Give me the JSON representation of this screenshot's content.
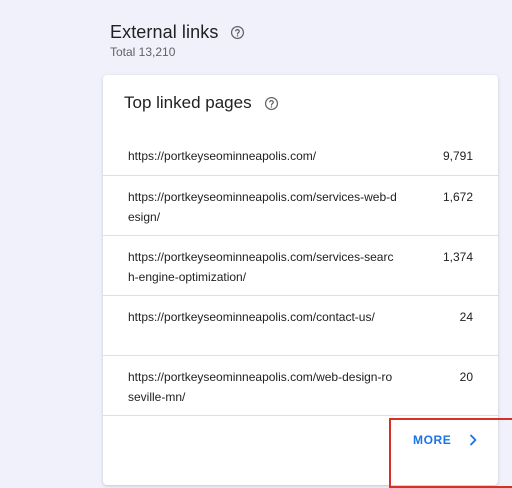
{
  "external_links": {
    "title": "External links",
    "total": "Total 13,210"
  },
  "top_linked_pages": {
    "title": "Top linked pages",
    "rows": [
      {
        "url": "https://portkeyseominneapolis.com/",
        "count": "9,791"
      },
      {
        "url": "https://portkeyseominneapolis.com/services-web-design/",
        "count": "1,672"
      },
      {
        "url": "https://portkeyseominneapolis.com/services-search-engine-optimization/",
        "count": "1,374"
      },
      {
        "url": "https://portkeyseominneapolis.com/contact-us/",
        "count": "24"
      },
      {
        "url": "https://portkeyseominneapolis.com/web-design-roseville-mn/",
        "count": "20"
      }
    ],
    "more_label": "MORE"
  },
  "icons": {
    "help": "help-circle-icon",
    "more": "chevron-right-icon"
  },
  "colors": {
    "accent": "#1a73e8",
    "highlight": "#d93025"
  }
}
